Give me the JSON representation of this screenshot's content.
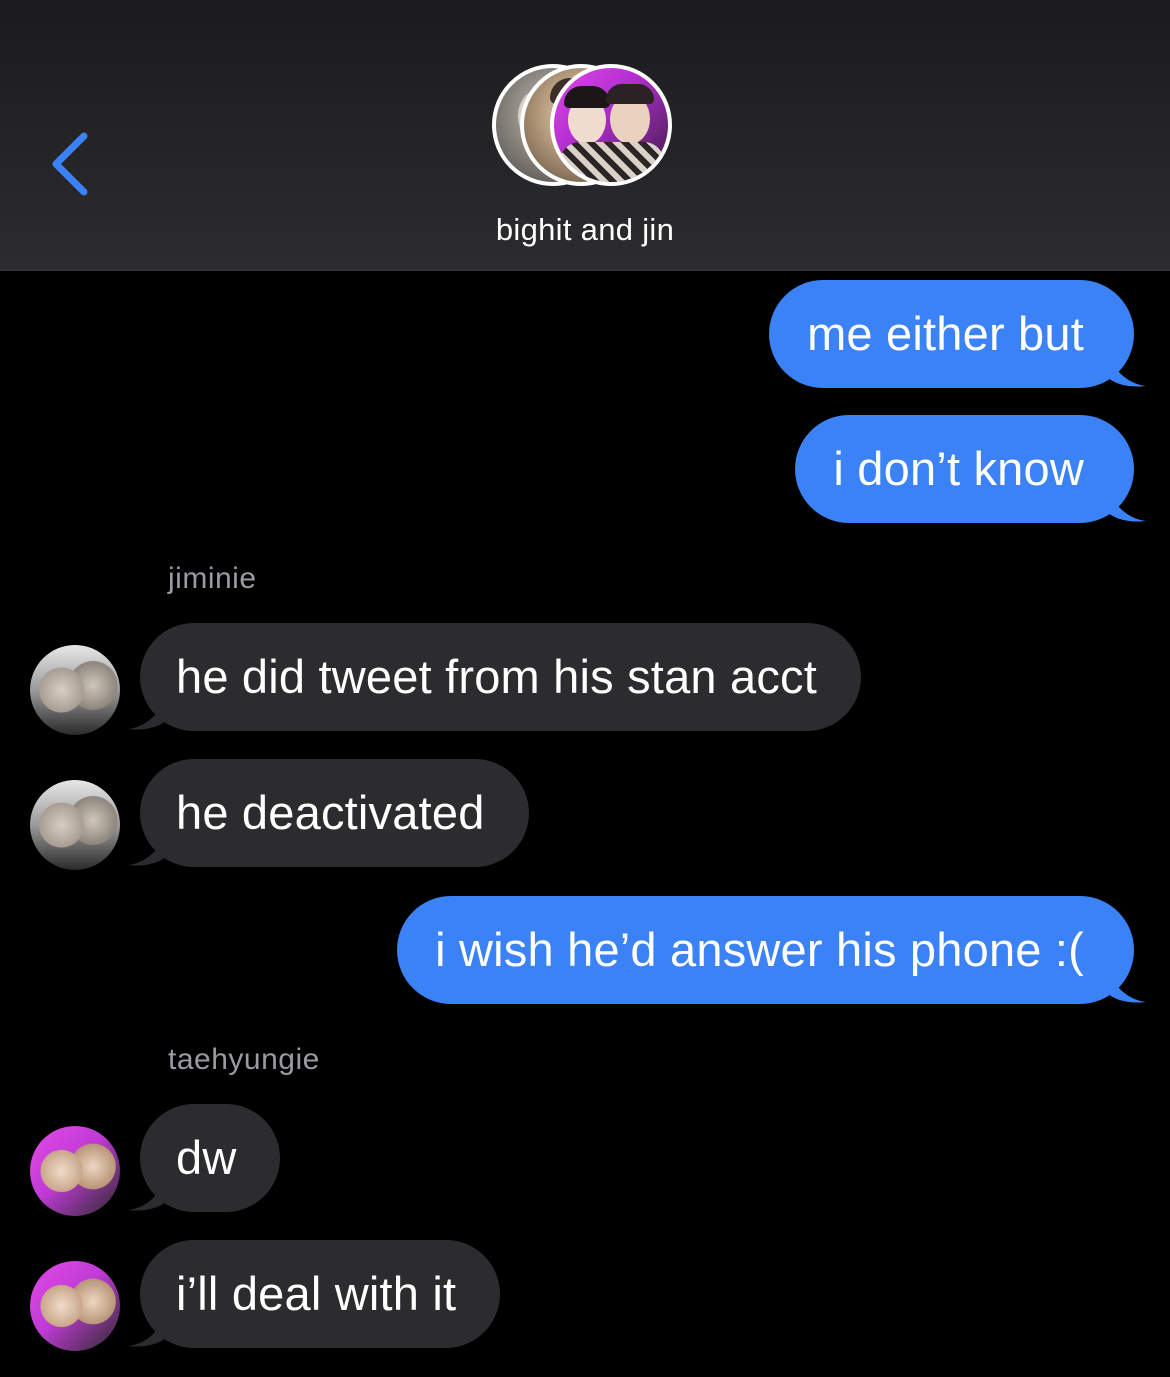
{
  "header": {
    "back_icon": "chevron-left-icon",
    "title": "bighit and jin",
    "accent_color": "#3a82f6"
  },
  "messages": [
    {
      "direction": "sent",
      "text": "me either but"
    },
    {
      "direction": "sent",
      "text": "i don’t know"
    },
    {
      "direction": "label",
      "text": "jiminie"
    },
    {
      "direction": "received",
      "sender": "jiminie",
      "text": "he did tweet from his stan acct"
    },
    {
      "direction": "received",
      "sender": "jiminie",
      "text": "he deactivated"
    },
    {
      "direction": "sent",
      "text": "i wish he’d answer his phone :("
    },
    {
      "direction": "label",
      "text": "taehyungie"
    },
    {
      "direction": "received",
      "sender": "taehyungie",
      "text": "dw"
    },
    {
      "direction": "received",
      "sender": "taehyungie",
      "text": "i’ll deal with it"
    }
  ],
  "colors": {
    "sent_bubble": "#3a82f6",
    "received_bubble": "#2c2c2e",
    "background": "#000000"
  }
}
